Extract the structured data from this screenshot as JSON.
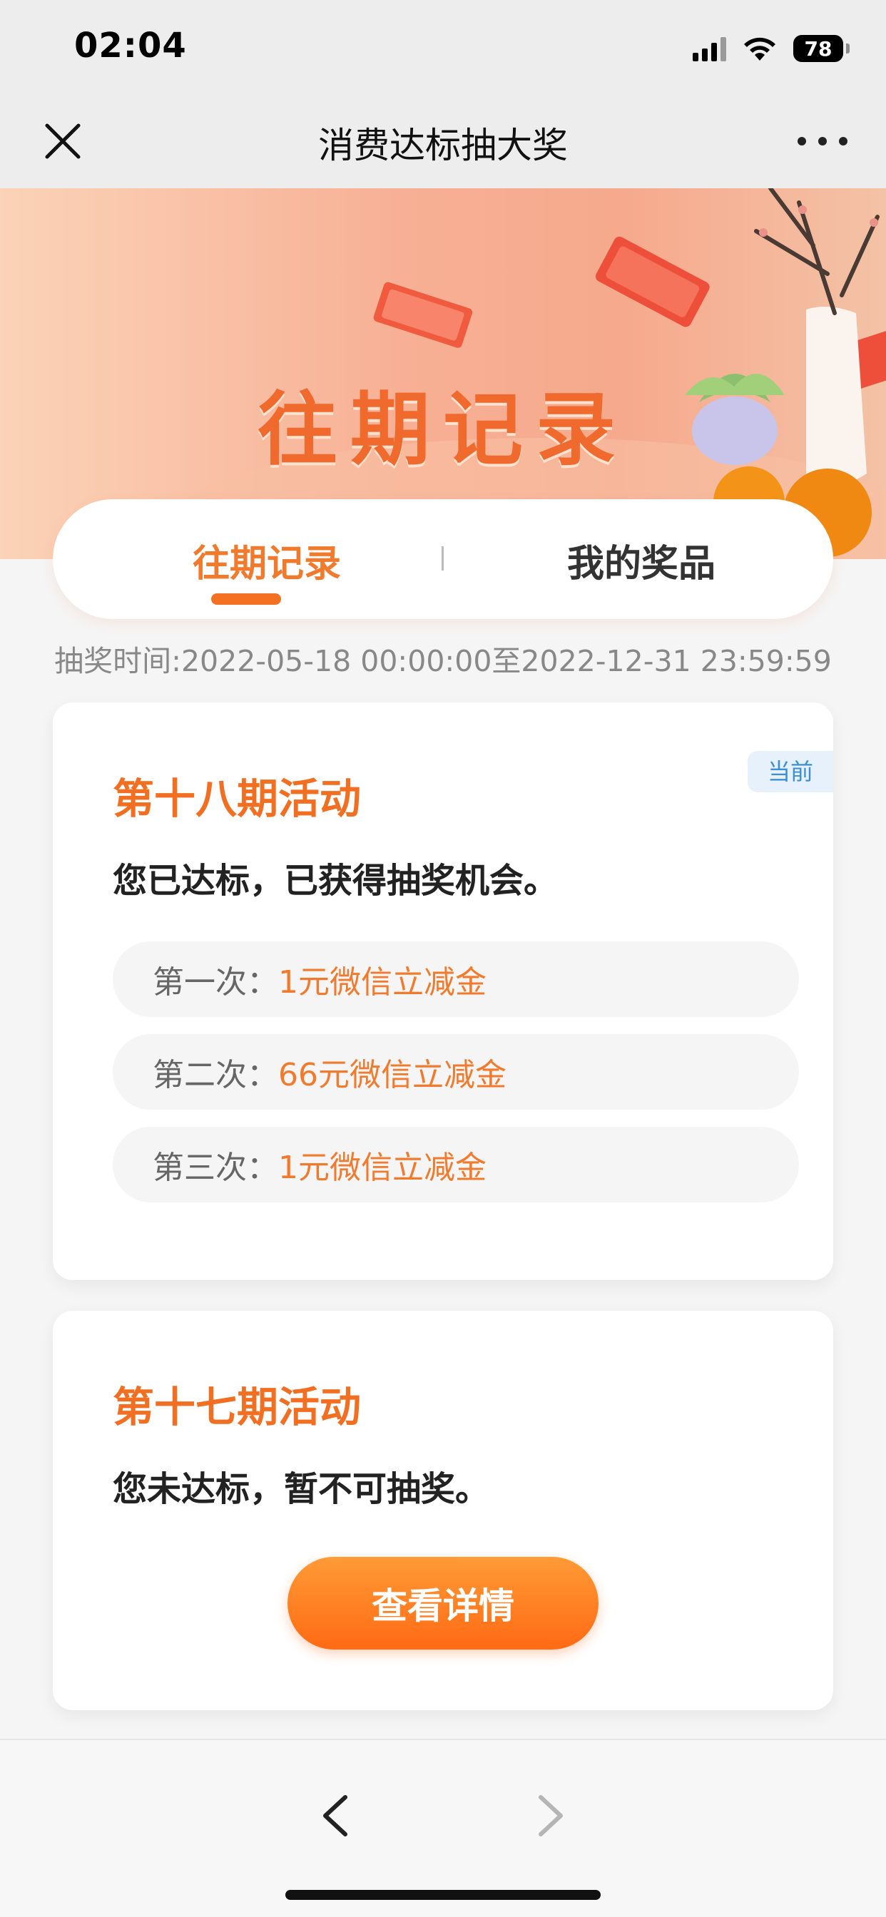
{
  "status_bar": {
    "time": "02:04",
    "battery": "78",
    "icons": [
      "signal-icon",
      "wifi-icon",
      "battery-icon"
    ]
  },
  "nav": {
    "title": "消费达标抽大奖",
    "close_icon": "close-icon",
    "more_icon": "more-icon"
  },
  "banner": {
    "title": "往期记录"
  },
  "tabs": [
    {
      "label": "往期记录",
      "active": true
    },
    {
      "label": "我的奖品",
      "active": false
    }
  ],
  "time_range": "抽奖时间:2022-05-18 00:00:00至2022-12-31 23:59:59",
  "activities": [
    {
      "title": "第十八期活动",
      "badge": "当前",
      "description": "您已达标，已获得抽奖机会。",
      "prizes": [
        {
          "label": "第一次：",
          "value": "1元微信立减金"
        },
        {
          "label": "第二次：",
          "value": "66元微信立减金"
        },
        {
          "label": "第三次：",
          "value": "1元微信立减金"
        }
      ]
    },
    {
      "title": "第十七期活动",
      "description": "您未达标，暂不可抽奖。",
      "button": "查看详情"
    }
  ],
  "colors": {
    "accent": "#f27a2c",
    "button_gradient_top": "#ff9b36",
    "button_gradient_bottom": "#ff6a13",
    "badge_text": "#3b8fd6",
    "badge_bg": "#e6f1fb"
  }
}
